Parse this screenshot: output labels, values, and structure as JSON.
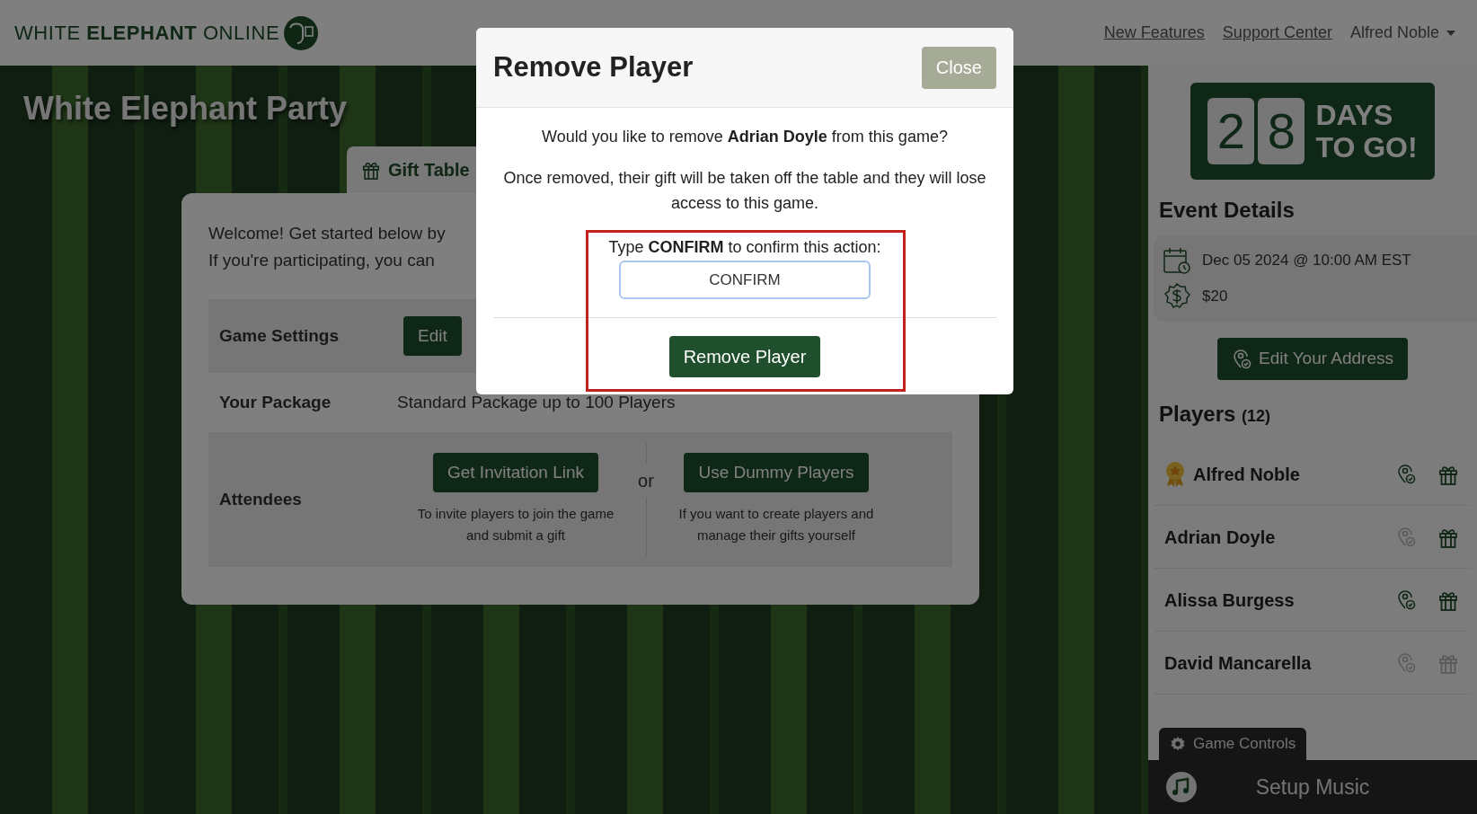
{
  "header": {
    "logo": "WHITE **ELEPHANT** ONLINE",
    "links": [
      "New Features",
      "Support Center"
    ],
    "user_menu": "Alfred Noble"
  },
  "page_title": "White Elephant Party",
  "tabs": [
    {
      "label": "Gift Table",
      "selected": true
    }
  ],
  "card": {
    "welcome_lines": [
      "Welcome! Get started below by",
      "If you're participating, you can"
    ],
    "rows": [
      {
        "kind": "action",
        "label": "Game Settings",
        "button": "Edit"
      },
      {
        "kind": "info",
        "label": "Your Package",
        "value": "Standard Package up to 100 Players"
      },
      {
        "kind": "options",
        "label": "Attendees",
        "separator": "or",
        "options": [
          {
            "button": "Get Invitation Link",
            "note": "To invite players to join the game and submit a gift"
          },
          {
            "button": "Use Dummy Players",
            "note": "If you want to create players and manage their gifts yourself"
          }
        ]
      }
    ]
  },
  "sidebar": {
    "countdown": {
      "digits": [
        "2",
        "8"
      ],
      "lines": [
        "DAYS",
        "TO GO!"
      ]
    },
    "event_details": {
      "title": "Event Details",
      "date": "Dec 05 2024 @ 10:00 AM EST",
      "price": "$20"
    },
    "address_button": "Edit Your Address",
    "players": {
      "title": "Players",
      "count": "(12)",
      "items": [
        {
          "name": "Alfred Noble",
          "host": true,
          "address_confirmed": true,
          "gift_submitted": true
        },
        {
          "name": "Adrian Doyle",
          "host": false,
          "address_confirmed": false,
          "gift_submitted": true
        },
        {
          "name": "Alissa Burgess",
          "host": false,
          "address_confirmed": true,
          "gift_submitted": true
        },
        {
          "name": "David Mancarella",
          "host": false,
          "address_confirmed": false,
          "gift_submitted": false
        }
      ]
    },
    "game_controls_tab": "Game Controls",
    "music_bar": "Setup Music"
  },
  "modal": {
    "title": "Remove Player",
    "close_button": "Close",
    "question": "Would you like to remove **Adrian Doyle** from this game?",
    "warning": "Once removed, their gift will be taken off the table and they will lose access to this game.",
    "confirm_label": "Type **CONFIRM** to confirm this action:",
    "confirm_value": "CONFIRM",
    "submit_button": "Remove Player"
  }
}
